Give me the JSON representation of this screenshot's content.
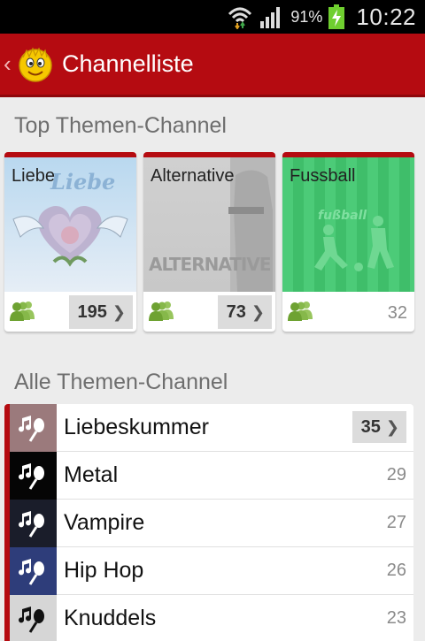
{
  "status": {
    "battery_pct": "91%",
    "time": "10:22"
  },
  "header": {
    "title": "Channelliste"
  },
  "top_section": {
    "title": "Top Themen-Channel",
    "cards": [
      {
        "label": "Liebe",
        "count": "195",
        "highlighted": true
      },
      {
        "label": "Alternative",
        "count": "73",
        "highlighted": true
      },
      {
        "label": "Fussball",
        "count": "32",
        "highlighted": false
      }
    ]
  },
  "all_section": {
    "title": "Alle Themen-Channel",
    "items": [
      {
        "label": "Liebeskummer",
        "count": "35",
        "highlighted": true,
        "color": "#9b7a7c"
      },
      {
        "label": "Metal",
        "count": "29",
        "highlighted": false,
        "color": "#050505"
      },
      {
        "label": "Vampire",
        "count": "27",
        "highlighted": false,
        "color": "#1a1d2a"
      },
      {
        "label": "Hip Hop",
        "count": "26",
        "highlighted": false,
        "color": "#2e3d7a"
      },
      {
        "label": "Knuddels",
        "count": "23",
        "highlighted": false,
        "color": "#d6d6d6"
      }
    ]
  },
  "colors": {
    "accent": "#b50b11",
    "users_icon": "#7bb23a"
  }
}
